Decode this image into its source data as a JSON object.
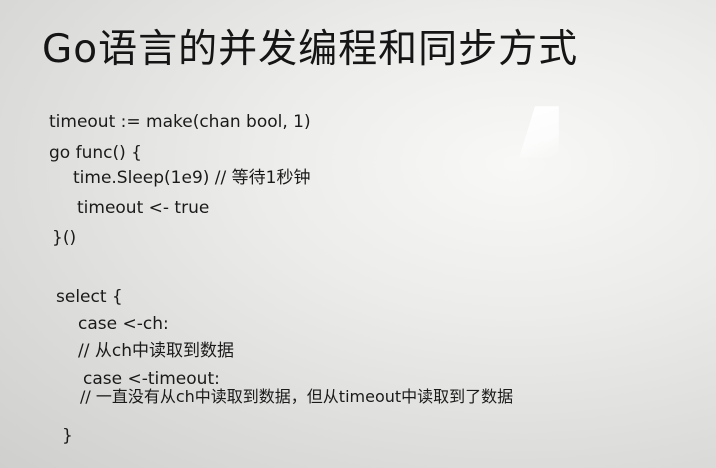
{
  "slide": {
    "title": "Go语言的并发编程和同步方式",
    "code_lines": [
      "timeout := make(chan bool, 1)",
      "go func() {",
      "time.Sleep(1e9) // 等待1秒钟",
      "timeout <- true",
      "}()",
      "select {",
      "case <-ch:",
      "// 从ch中读取到数据",
      "case <-timeout:",
      "// 一直没有从ch中读取到数据，但从timeout中读取到了数据",
      "}"
    ]
  }
}
